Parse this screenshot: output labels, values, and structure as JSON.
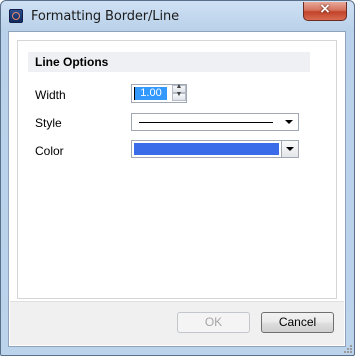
{
  "window": {
    "title": "Formatting Border/Line",
    "close_label": "×"
  },
  "section": {
    "header": "Line Options"
  },
  "fields": {
    "width_label": "Width",
    "width_value": "1.00",
    "style_label": "Style",
    "color_label": "Color"
  },
  "line_color": "#3a6be8",
  "buttons": {
    "ok_label": "OK",
    "cancel_label": "Cancel"
  }
}
